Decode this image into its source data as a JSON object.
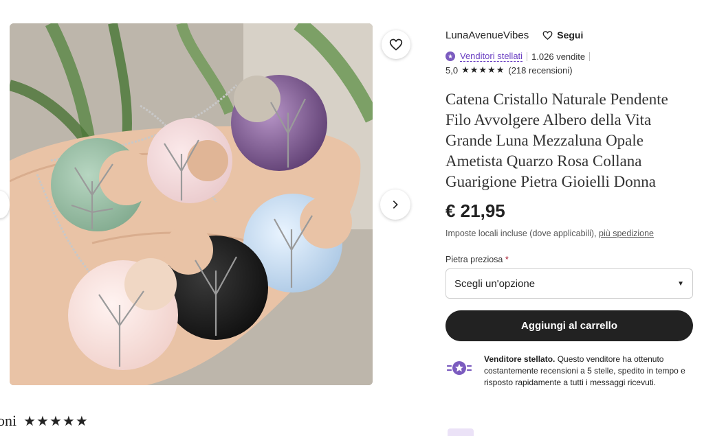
{
  "product": {
    "favorite_label": "Aggiungi ai preferiti",
    "next_label": "Immagine successiva"
  },
  "reviews_fragment": {
    "text": "oni",
    "stars": "★★★★★"
  },
  "shop": {
    "name": "LunaAvenueVibes",
    "follow": "Segui",
    "star_seller": "Venditori stellati",
    "sales": "1.026 vendite",
    "rating": "5,0",
    "stars": "★★★★★",
    "reviews": "(218 recensioni)"
  },
  "listing": {
    "title": "Catena Cristallo Naturale Pendente Filo Avvolgere Albero della Vita Grande Luna Mezzaluna Opale Ametista Quarzo Rosa Collana Guarigione Pietra Gioielli Donna",
    "price": "€ 21,95",
    "tax_note": "Imposte locali incluse (dove applicabili),",
    "shipping_link": "più spedizione"
  },
  "variation": {
    "label": "Pietra preziosa",
    "required_mark": "*",
    "selected": "Scegli un'opzione"
  },
  "cart": {
    "button": "Aggiungi al carrello"
  },
  "seller_info": {
    "heading": "Venditore stellato.",
    "body": "Questo venditore ha ottenuto costantemente recensioni a 5 stelle, spedito in tempo e risposto rapidamente a tutti i messaggi ricevuti."
  },
  "colors": {
    "accent_purple": "#6a3fc2",
    "button_dark": "#222222",
    "required_red": "#a61a2e"
  }
}
